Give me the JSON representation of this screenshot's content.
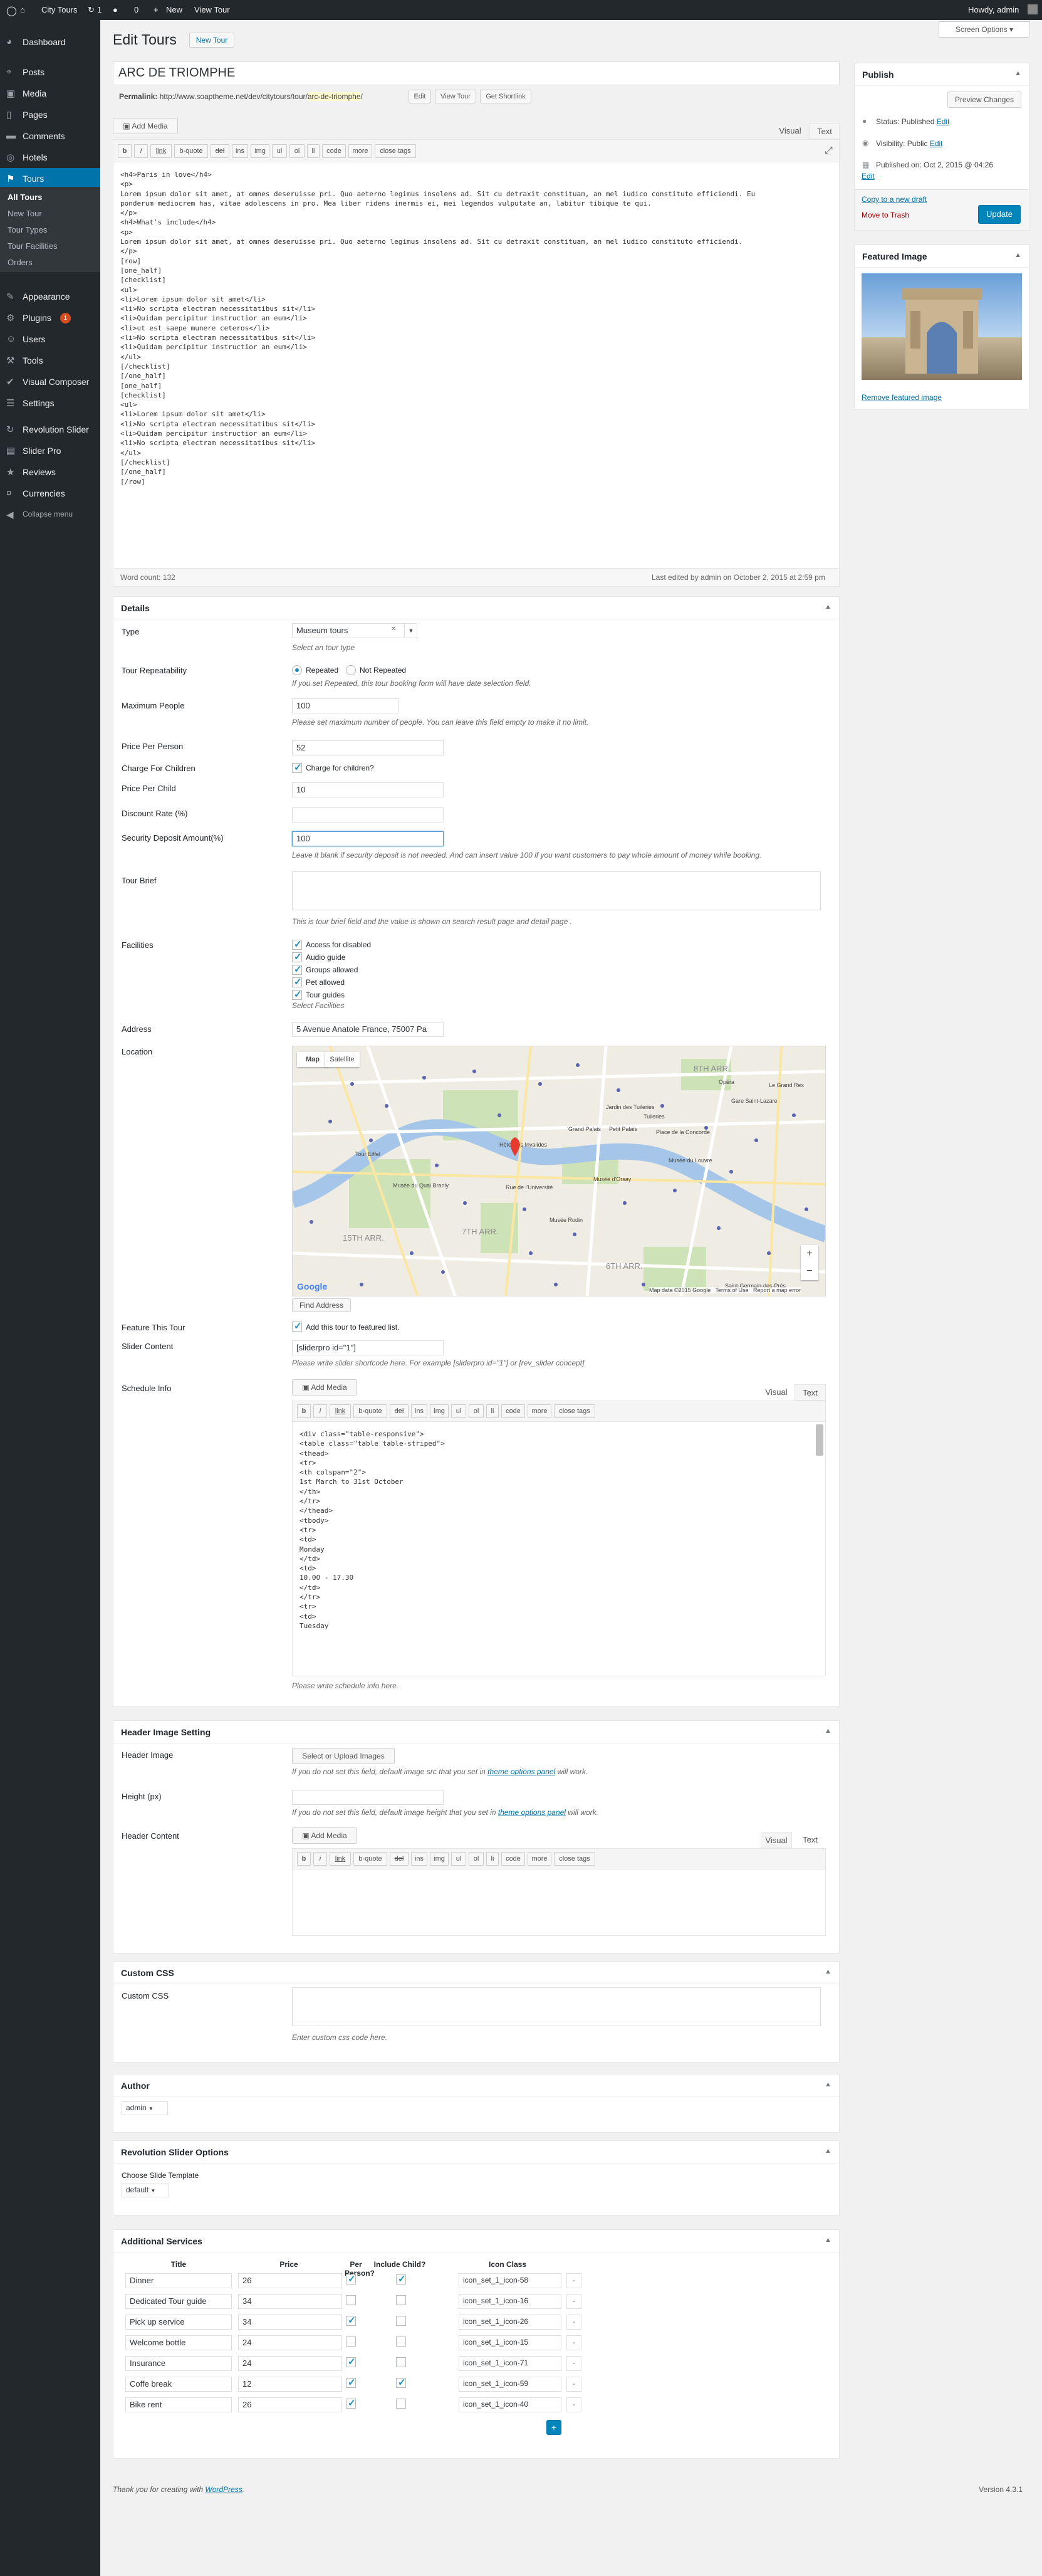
{
  "adminbar": {
    "site": "City Tours",
    "updates": "1",
    "comments": "0",
    "new": "New",
    "view": "View Tour",
    "howdy": "Howdy, admin"
  },
  "menu": [
    {
      "label": "Dashboard",
      "icon": "dashboard-icon"
    },
    {
      "label": "Posts",
      "icon": "pin-icon"
    },
    {
      "label": "Media",
      "icon": "media-icon"
    },
    {
      "label": "Pages",
      "icon": "page-icon"
    },
    {
      "label": "Comments",
      "icon": "comment-icon"
    },
    {
      "label": "Hotels",
      "icon": "hotel-icon"
    },
    {
      "label": "Tours",
      "icon": "tours-icon"
    }
  ],
  "tours_sub": [
    "All Tours",
    "New Tour",
    "Tour Types",
    "Tour Facilities",
    "Orders"
  ],
  "menu2": [
    {
      "label": "Appearance",
      "icon": "brush-icon"
    },
    {
      "label": "Plugins",
      "icon": "plugin-icon",
      "badge": "1"
    },
    {
      "label": "Users",
      "icon": "users-icon"
    },
    {
      "label": "Tools",
      "icon": "wrench-icon"
    },
    {
      "label": "Visual Composer",
      "icon": "vc-icon"
    },
    {
      "label": "Settings",
      "icon": "settings-icon"
    },
    {
      "label": "Revolution Slider",
      "icon": "refresh-icon"
    },
    {
      "label": "Slider Pro",
      "icon": "slides-icon"
    },
    {
      "label": "Reviews",
      "icon": "star-icon"
    },
    {
      "label": "Currencies",
      "icon": "money-icon"
    },
    {
      "label": "Collapse menu",
      "icon": "collapse-icon"
    }
  ],
  "screen_options": "Screen Options ▾",
  "page": {
    "title": "Edit Tours",
    "new_btn": "New Tour"
  },
  "post": {
    "title": "ARC DE TRIOMPHE",
    "permalink_label": "Permalink:",
    "permalink_base": "http://www.soaptheme.net/dev/citytours/tour/",
    "permalink_slug": "arc-de-triomphe",
    "permalink_end": "/",
    "edit": "Edit",
    "view": "View Tour",
    "shortlink": "Get Shortlink"
  },
  "editor": {
    "add_media": "Add Media",
    "tab_visual": "Visual",
    "tab_text": "Text",
    "qt": [
      "b",
      "i",
      "link",
      "b-quote",
      "del",
      "ins",
      "img",
      "ul",
      "ol",
      "li",
      "code",
      "more",
      "close tags"
    ],
    "content": "<h4>Paris in love</h4>\n<p>\nLorem ipsum dolor sit amet, at omnes deseruisse pri. Quo aeterno legimus insolens ad. Sit cu detraxit constituam, an mel iudico constituto efficiendi. Eu\nponderum mediocrem has, vitae adolescens in pro. Mea liber ridens inermis ei, mei legendos vulputate an, labitur tibique te qui.\n</p>\n<h4>What's include</h4>\n<p>\nLorem ipsum dolor sit amet, at omnes deseruisse pri. Quo aeterno legimus insolens ad. Sit cu detraxit constituam, an mel iudico constituto efficiendi.\n</p>\n[row]\n[one_half]\n[checklist]\n<ul>\n<li>Lorem ipsum dolor sit amet</li>\n<li>No scripta electram necessitatibus sit</li>\n<li>Quidam percipitur instructior an eum</li>\n<li>ut est saepe munere ceteros</li>\n<li>No scripta electram necessitatibus sit</li>\n<li>Quidam percipitur instructior an eum</li>\n</ul>\n[/checklist]\n[/one_half]\n[one_half]\n[checklist]\n<ul>\n<li>Lorem ipsum dolor sit amet</li>\n<li>No scripta electram necessitatibus sit</li>\n<li>Quidam percipitur instructior an eum</li>\n<li>No scripta electram necessitatibus sit</li>\n</ul>\n[/checklist]\n[/one_half]\n[/row]",
    "word_count": "Word count: 132",
    "last_edited": "Last edited by admin on October 2, 2015 at 2:59 pm"
  },
  "publish": {
    "title": "Publish",
    "preview": "Preview Changes",
    "status": "Status: Published",
    "status_edit": "Edit",
    "visibility": "Visibility: Public",
    "visibility_edit": "Edit",
    "published": "Published on: Oct 2, 2015 @ 04:26",
    "published_edit": "Edit",
    "copy": "Copy to a new draft",
    "trash": "Move to Trash",
    "update": "Update"
  },
  "featured": {
    "title": "Featured Image",
    "remove": "Remove featured image"
  },
  "details": {
    "title": "Details",
    "type_label": "Type",
    "type_value": "Museum tours",
    "type_desc": "Select an tour type",
    "repeat_label": "Tour Repeatability",
    "repeat_opt1": "Repeated",
    "repeat_opt2": "Not Repeated",
    "repeat_desc": "If you set Repeated, this tour booking form will have date selection field.",
    "maxp_label": "Maximum People",
    "maxp_value": "100",
    "maxp_desc": "Please set maximum number of people. You can leave this field empty to make it no limit.",
    "ppp_label": "Price Per Person",
    "ppp_value": "52",
    "cfc_label": "Charge For Children",
    "cfc_text": "Charge for children?",
    "ppc_label": "Price Per Child",
    "ppc_value": "10",
    "disc_label": "Discount Rate (%)",
    "disc_value": "",
    "sec_label": "Security Deposit Amount(%)",
    "sec_value": "100",
    "sec_desc": "Leave it blank if security deposit is not needed. And can insert value 100 if you want customers to pay whole amount of money while booking.",
    "brief_label": "Tour Brief",
    "brief_desc": "This is tour brief field and the value is shown on search result page and detail page .",
    "fac_label": "Facilities",
    "facilities": [
      "Access for disabled",
      "Audio guide",
      "Groups allowed",
      "Pet allowed",
      "Tour guides"
    ],
    "fac_desc": "Select Facilities",
    "addr_label": "Address",
    "addr_value": "5 Avenue Anatole France, 75007 Pa",
    "loc_label": "Location",
    "map_tab1": "Map",
    "map_tab2": "Satellite",
    "map_footer": "Map data ©2015 Google   Terms of Use   Report a map error",
    "google": "Google",
    "find_addr": "Find Address",
    "map_labels": [
      "8TH ARR.",
      "Grand Palais",
      "Petit Palais",
      "Place de la Concorde",
      "Musée du Louvre",
      "Musée d'Orsay",
      "Musée du Quai Branly",
      "Rue de l'Université",
      "Tour Eiffel",
      "15TH ARR.",
      "7TH ARR.",
      "6TH ARR.",
      "Musée Rodin",
      "Hôtel des Invalides",
      "Saint-Germain-des-Prés",
      "Gare Saint-Lazare",
      "Le Grand Rex",
      "Opéra",
      "Jardin des Tuileries",
      "Tuileries"
    ],
    "feat_label": "Feature This Tour",
    "feat_text": "Add this tour to featured list.",
    "slider_label": "Slider Content",
    "slider_value": "[sliderpro id=\"1\"]",
    "slider_desc": "Please write slider shortcode here. For example [sliderpro id=\"1\"] or [rev_slider concept]",
    "sched_label": "Schedule Info",
    "sched_add_media": "Add Media",
    "sched_visual": "Visual",
    "sched_text": "Text",
    "sched_content": "<div class=\"table-responsive\">\n<table class=\"table table-striped\">\n<thead>\n<tr>\n<th colspan=\"2\">\n1st March to 31st October\n</th>\n</tr>\n</thead>\n<tbody>\n<tr>\n<td>\nMonday\n</td>\n<td>\n10.00 - 17.30\n</td>\n</tr>\n<tr>\n<td>\nTuesday",
    "sched_desc": "Please write schedule info here."
  },
  "header_img": {
    "title": "Header Image Setting",
    "img_label": "Header Image",
    "img_btn": "Select or Upload Images",
    "img_desc_a": "If you do not set this field, default image src that you set in ",
    "img_desc_link": "theme options panel",
    "img_desc_b": " will work.",
    "h_label": "Height (px)",
    "h_desc_a": "If you do not set this field, default image height that you set in ",
    "h_desc_link": "theme options panel",
    "h_desc_b": " will work.",
    "content_label": "Header Content",
    "add_media": "Add Media",
    "visual": "Visual",
    "text": "Text"
  },
  "css": {
    "title": "Custom CSS",
    "label": "Custom CSS",
    "desc": "Enter custom css code here."
  },
  "author": {
    "title": "Author",
    "value": "admin"
  },
  "revslider": {
    "title": "Revolution Slider Options",
    "label": "Choose Slide Template",
    "value": "default"
  },
  "services": {
    "title": "Additional Services",
    "headers": [
      "Title",
      "Price",
      "Per Person?",
      "Include Child?",
      "Icon Class"
    ],
    "rows": [
      {
        "title": "Dinner",
        "price": "26",
        "pp": true,
        "ic": true,
        "icon": "icon_set_1_icon-58"
      },
      {
        "title": "Dedicated Tour guide",
        "price": "34",
        "pp": false,
        "ic": false,
        "icon": "icon_set_1_icon-16"
      },
      {
        "title": "Pick up service",
        "price": "34",
        "pp": true,
        "ic": false,
        "icon": "icon_set_1_icon-26"
      },
      {
        "title": "Welcome bottle",
        "price": "24",
        "pp": false,
        "ic": false,
        "icon": "icon_set_1_icon-15"
      },
      {
        "title": "Insurance",
        "price": "24",
        "pp": true,
        "ic": false,
        "icon": "icon_set_1_icon-71"
      },
      {
        "title": "Coffe break",
        "price": "12",
        "pp": true,
        "ic": true,
        "icon": "icon_set_1_icon-59"
      },
      {
        "title": "Bike rent",
        "price": "26",
        "pp": true,
        "ic": false,
        "icon": "icon_set_1_icon-40"
      }
    ],
    "remove": "-",
    "add": "+"
  },
  "footer": {
    "thanks": "Thank you for creating with ",
    "wp": "WordPress",
    "dot": ".",
    "version": "Version 4.3.1"
  },
  "colors": {
    "accent": "#0073aa",
    "admin_dark": "#23282d",
    "trash": "#a00",
    "map_water": "#a5c6e8",
    "map_land": "#efece4"
  }
}
